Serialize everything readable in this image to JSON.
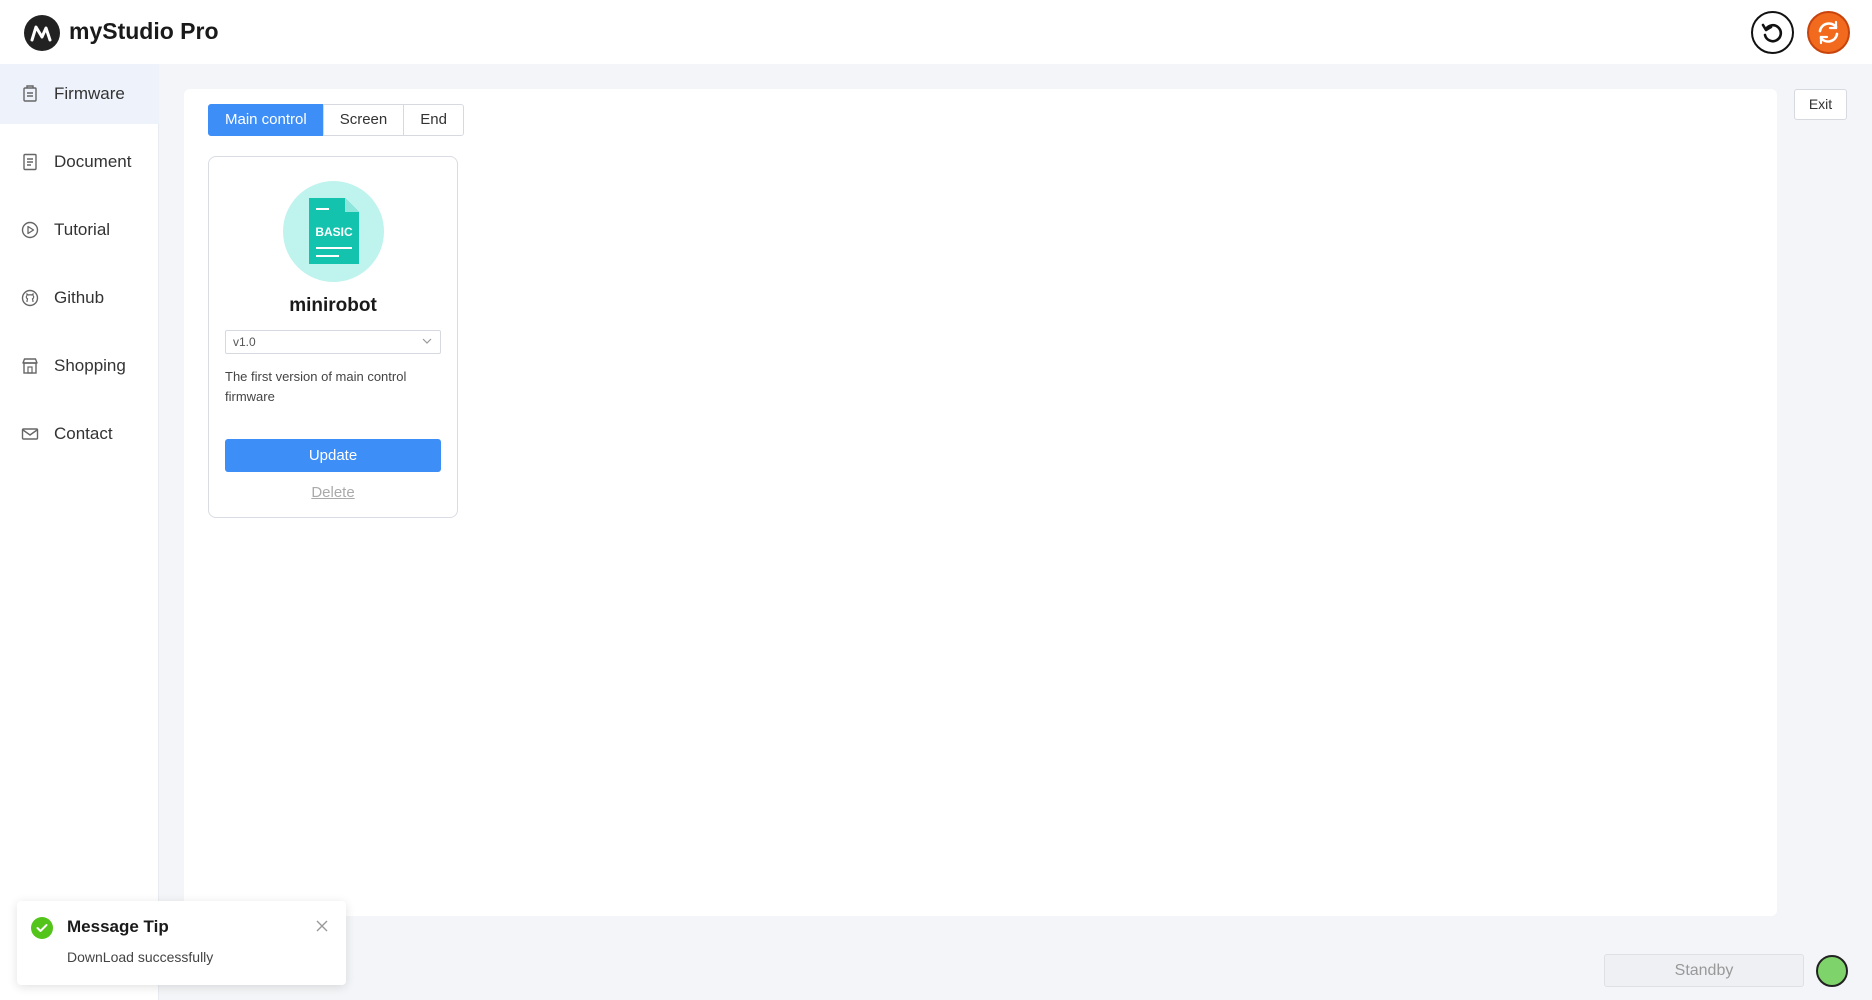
{
  "app": {
    "title": "myStudio Pro"
  },
  "header": {
    "undo_icon": "undo-icon",
    "sync_icon": "sync-icon"
  },
  "sidebar": {
    "items": [
      {
        "label": "Firmware",
        "icon": "firmware-icon",
        "active": true
      },
      {
        "label": "Document",
        "icon": "document-icon",
        "active": false
      },
      {
        "label": "Tutorial",
        "icon": "play-icon",
        "active": false
      },
      {
        "label": "Github",
        "icon": "github-icon",
        "active": false
      },
      {
        "label": "Shopping",
        "icon": "shop-icon",
        "active": false
      },
      {
        "label": "Contact",
        "icon": "mail-icon",
        "active": false
      }
    ]
  },
  "tabs": [
    {
      "label": "Main control",
      "active": true
    },
    {
      "label": "Screen",
      "active": false
    },
    {
      "label": "End",
      "active": false
    }
  ],
  "firmware_card": {
    "icon_text": "BASIC",
    "name": "minirobot",
    "version_selected": "v1.0",
    "description": "The first version of main control firmware",
    "update_label": "Update",
    "delete_label": "Delete"
  },
  "exit_label": "Exit",
  "bottom": {
    "standby_label": "Standby",
    "status_color": "#7fd36b"
  },
  "toast": {
    "title": "Message Tip",
    "message": "DownLoad successfully"
  },
  "colors": {
    "primary": "#3e8ef7",
    "success": "#52c41a",
    "accent_icon_bg": "#bff3ee",
    "sync": "#f26a1e"
  }
}
